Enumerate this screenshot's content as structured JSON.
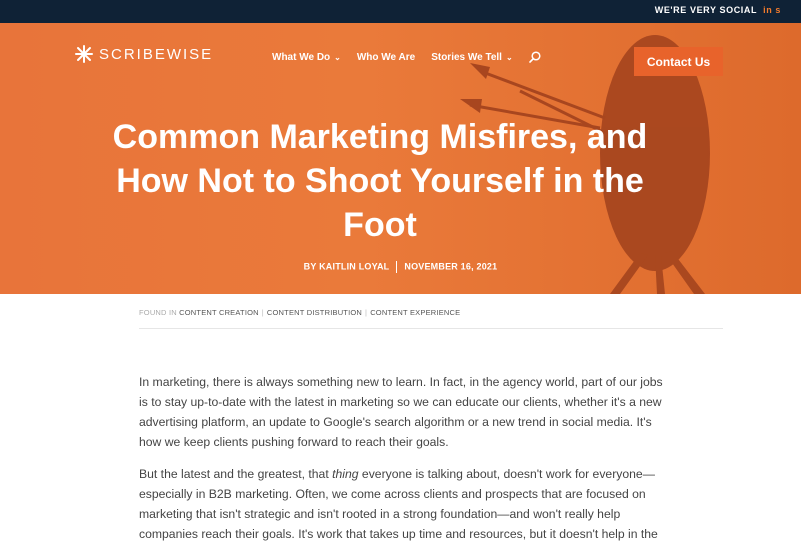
{
  "topbar": {
    "text": "WE'RE VERY SOCIAL",
    "link": "in s"
  },
  "brand": {
    "logo_text": "SCRIBEWISE"
  },
  "nav": {
    "items": [
      {
        "label": "What We Do",
        "has_dropdown": true
      },
      {
        "label": "Who We Are",
        "has_dropdown": false
      },
      {
        "label": "Stories We Tell",
        "has_dropdown": true
      }
    ],
    "cta_label": "Contact Us"
  },
  "hero": {
    "title": "Common Marketing Misfires, and How Not to Shoot Yourself in the Foot",
    "author": "BY KAITLIN LOYAL",
    "date": "NOVEMBER 16, 2021"
  },
  "categories": {
    "prefix": "FOUND IN",
    "items": [
      "CONTENT CREATION",
      "CONTENT DISTRIBUTION",
      "CONTENT EXPERIENCE"
    ]
  },
  "article": {
    "paragraph_1": "In marketing, there is always something new to learn. In fact, in the agency world, part of our jobs is to stay up-to-date with the latest in marketing so we can educate our clients, whether it's a new advertising platform, an update to Google's search algorithm or a new trend in social media. It's how we keep clients pushing forward to reach their goals.",
    "paragraph_2a": "But the latest and the greatest, that ",
    "paragraph_2_em": "thing",
    "paragraph_2b": " everyone is talking about, doesn't work for everyone—especially in B2B marketing. Often, we come across clients and prospects that are focused on marketing that isn't strategic and isn't rooted in a strong foundation—and won't really help companies reach their goals. It's work that takes up time and resources, but it doesn't help in the"
  },
  "colors": {
    "topbar": "#0f2236",
    "hero": "#ea7a3a",
    "cta": "#e8632b",
    "target": "#a8461f"
  }
}
